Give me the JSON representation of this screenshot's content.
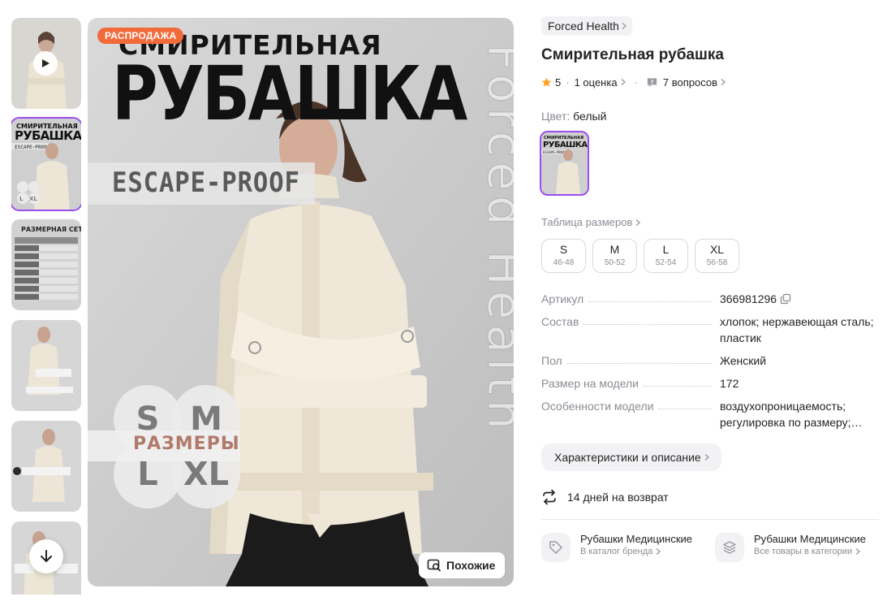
{
  "gallery": {
    "thumbnails": [
      {
        "kind": "video"
      },
      {
        "kind": "cover",
        "title_small": "СМИРИТЕЛЬНАЯ",
        "title_big": "РУБАШКА",
        "subtitle": "ESCAPE-PROOF"
      },
      {
        "kind": "size-chart",
        "title": "РАЗМЕРНАЯ СЕТКА"
      },
      {
        "kind": "feature"
      },
      {
        "kind": "feature"
      },
      {
        "kind": "feature"
      }
    ],
    "main": {
      "sale_badge": "РАСПРОДАЖА",
      "headline_small": "СМИРИТЕЛЬНАЯ",
      "headline_big": "РУБАШКА",
      "subtitle": "ESCAPE-PROOF",
      "brand_watermark": "Forced Health",
      "sizes_word": "РАЗМЕРЫ",
      "size_circles": [
        "S",
        "M",
        "L",
        "XL"
      ],
      "similar_button": "Похожие"
    }
  },
  "product": {
    "brand": "Forced Health",
    "title": "Смирительная рубашка",
    "rating": "5",
    "reviews_link": "1 оценка",
    "questions_link": "7 вопросов",
    "color_label": "Цвет:",
    "color_value": "белый",
    "size_table_link": "Таблица размеров",
    "sizes": [
      {
        "size": "S",
        "range": "46-48"
      },
      {
        "size": "M",
        "range": "50-52"
      },
      {
        "size": "L",
        "range": "52-54"
      },
      {
        "size": "XL",
        "range": "56-58"
      }
    ],
    "specs": [
      {
        "key": "Артикул",
        "value": "366981296"
      },
      {
        "key": "Состав",
        "value": "хлопок; нержавеющая сталь; пластик"
      },
      {
        "key": "Пол",
        "value": "Женский"
      },
      {
        "key": "Размер на модели",
        "value": "172"
      },
      {
        "key": "Особенности модели",
        "value": "воздухопроницаемость; регулировка по размеру;…"
      }
    ],
    "details_button": "Характеристики и описание",
    "return_text": "14 дней на возврат",
    "categories": [
      {
        "title": "Рубашки Медицинские",
        "subtitle": "В каталог бренда",
        "icon": "tag-icon"
      },
      {
        "title": "Рубашки Медицинские",
        "subtitle": "Все товары в категории",
        "icon": "layers-icon"
      }
    ]
  },
  "colors": {
    "accent": "#9b4df0",
    "sale": "#f26a3a",
    "star": "#ff9f1a",
    "muted": "#8b8b95"
  }
}
